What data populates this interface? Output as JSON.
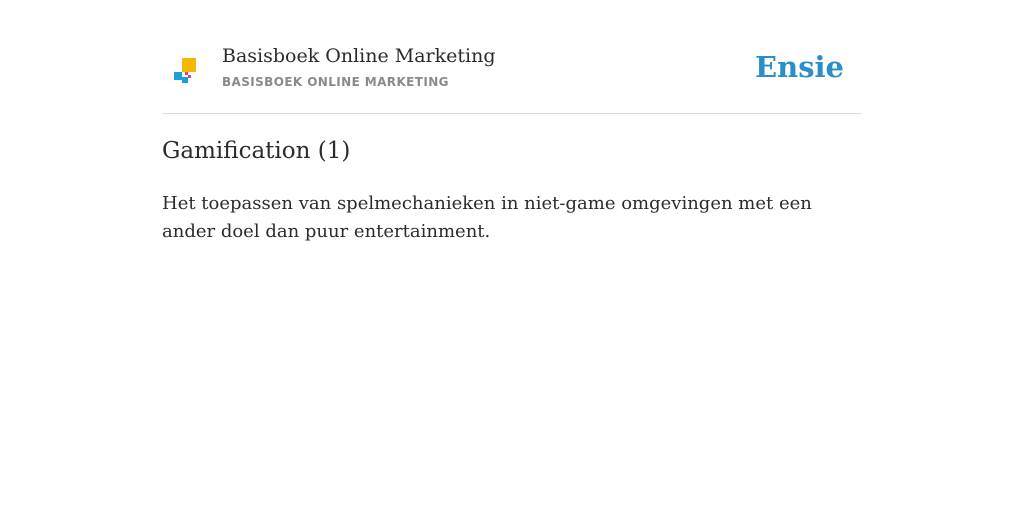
{
  "header": {
    "book_title": "Basisboek Online Marketing",
    "book_subtitle": "BASISBOEK ONLINE MARKETING",
    "brand": "Ensie",
    "logo_icon": "basisboek-logo-icon",
    "colors": {
      "brand": "#2a8fc6",
      "logo_yellow": "#f5b800",
      "logo_blue": "#1a9fd6",
      "logo_pink": "#e8417f"
    }
  },
  "entry": {
    "term": "Gamification (1)",
    "definition": "Het toepassen van spelmechanieken in niet-game omgevingen met een ander doel dan puur entertainment."
  }
}
